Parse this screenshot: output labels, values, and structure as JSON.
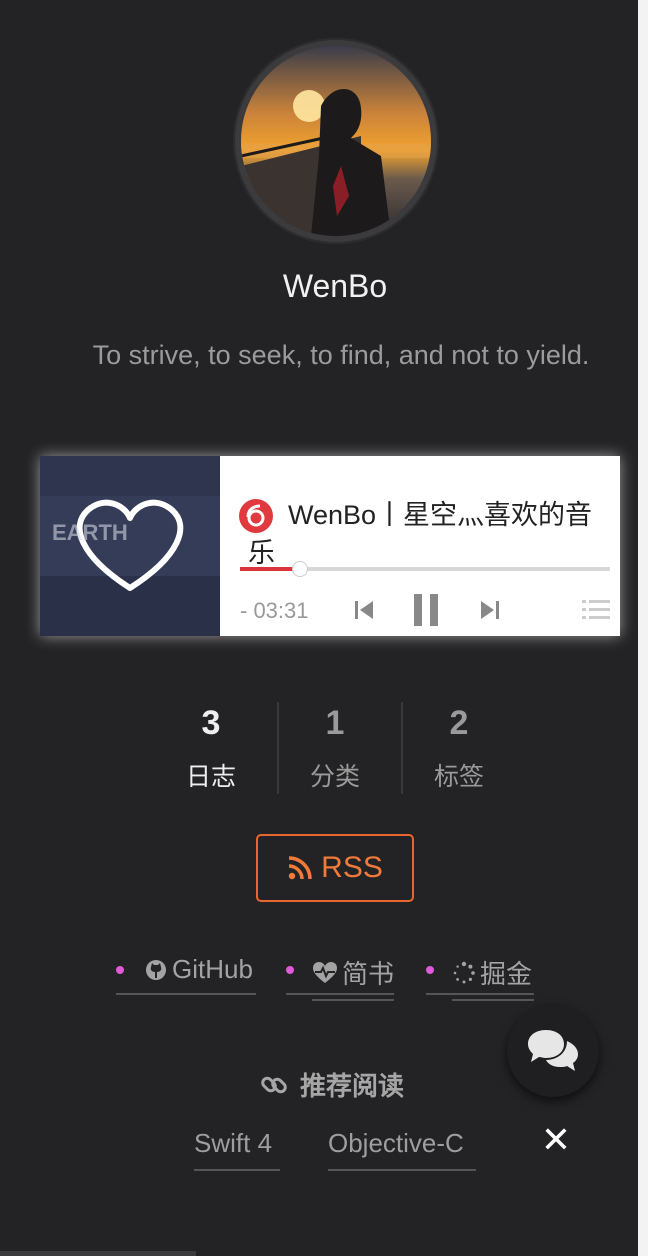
{
  "profile": {
    "name": "WenBo",
    "motto": "To strive, to seek, to find, and not to yield."
  },
  "player": {
    "song_title": "WenBo丨星空灬喜欢的音乐",
    "time": "- 03:31",
    "progress": 0.16,
    "cover_text": "EARTH",
    "accent": "#d8363a"
  },
  "stats": [
    {
      "count": "3",
      "label": "日志"
    },
    {
      "count": "1",
      "label": "分类"
    },
    {
      "count": "2",
      "label": "标签"
    }
  ],
  "rss": {
    "label": "RSS",
    "color": "#e8672e"
  },
  "social_links": [
    {
      "label": "GitHub",
      "icon": "github-icon"
    },
    {
      "label": "简书",
      "icon": "heartbeat-icon"
    },
    {
      "label": "掘金",
      "icon": "spinner-icon"
    }
  ],
  "recommended": {
    "title": "推荐阅读",
    "links": [
      "Swift 4",
      "Objective-C"
    ]
  },
  "close_label": "✕"
}
